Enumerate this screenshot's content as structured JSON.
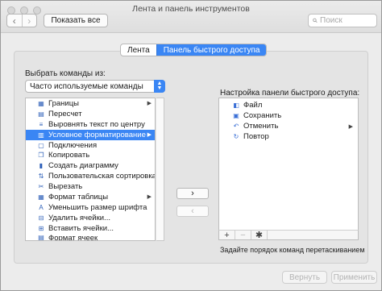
{
  "window": {
    "title": "Лента и панель инструментов"
  },
  "toolbar": {
    "back_icon": "‹",
    "forward_icon": "›",
    "show_all_label": "Показать все",
    "search_placeholder": "Поиск"
  },
  "tabs": [
    {
      "label": "Лента",
      "active": false
    },
    {
      "label": "Панель быстрого доступа",
      "active": true
    }
  ],
  "left": {
    "choose_label": "Выбрать команды из:",
    "dropdown_value": "Часто используемые команды",
    "items": [
      {
        "label": "Границы",
        "icon": "borders-icon",
        "glyph": "▦",
        "submenu": true
      },
      {
        "label": "Пересчет",
        "icon": "recalc-icon",
        "glyph": "▤",
        "submenu": false
      },
      {
        "label": "Выровнять текст по центру",
        "icon": "align-center-icon",
        "glyph": "≡",
        "submenu": false
      },
      {
        "label": "Условное форматирование",
        "icon": "conditional-format-icon",
        "glyph": "▥",
        "submenu": true,
        "selected": true
      },
      {
        "label": "Подключения",
        "icon": "connections-icon",
        "glyph": "▢",
        "submenu": false
      },
      {
        "label": "Копировать",
        "icon": "copy-icon",
        "glyph": "❐",
        "submenu": false
      },
      {
        "label": "Создать диаграмму",
        "icon": "chart-icon",
        "glyph": "▮",
        "submenu": false
      },
      {
        "label": "Пользовательская сортировка...",
        "icon": "sort-icon",
        "glyph": "⇅",
        "submenu": false
      },
      {
        "label": "Вырезать",
        "icon": "scissors-icon",
        "glyph": "✂",
        "submenu": false
      },
      {
        "label": "Формат таблицы",
        "icon": "table-format-icon",
        "glyph": "▦",
        "submenu": true
      },
      {
        "label": "Уменьшить размер шрифта",
        "icon": "font-decrease-icon",
        "glyph": "A",
        "submenu": false
      },
      {
        "label": "Удалить ячейки...",
        "icon": "delete-cells-icon",
        "glyph": "⊟",
        "submenu": false
      },
      {
        "label": "Вставить ячейки...",
        "icon": "insert-cells-icon",
        "glyph": "⊞",
        "submenu": false
      },
      {
        "label": "Формат ячеек",
        "icon": "format-cells-icon",
        "glyph": "▤",
        "submenu": false,
        "partial": true
      }
    ]
  },
  "move": {
    "add_icon": "›",
    "remove_icon": "‹"
  },
  "right": {
    "label": "Настройка панели быстрого доступа:",
    "items": [
      {
        "label": "Файл",
        "icon": "file-icon",
        "glyph": "◧",
        "color": "#3a6fd6"
      },
      {
        "label": "Сохранить",
        "icon": "save-icon",
        "glyph": "▣",
        "color": "#3a6fd6"
      },
      {
        "label": "Отменить",
        "icon": "undo-icon",
        "glyph": "↶",
        "color": "#3a6fd6",
        "submenu": true
      },
      {
        "label": "Повтор",
        "icon": "redo-icon",
        "glyph": "↻",
        "color": "#3a6fd6"
      }
    ],
    "bar": {
      "add": "+",
      "remove": "−",
      "settings": "✱"
    },
    "hint": "Задайте порядок команд перетаскиванием"
  },
  "footer": {
    "reset_label": "Вернуть",
    "apply_label": "Применить"
  },
  "colors": {
    "accent": "#3a86f4",
    "disabled_text": "#b3b3b3"
  }
}
